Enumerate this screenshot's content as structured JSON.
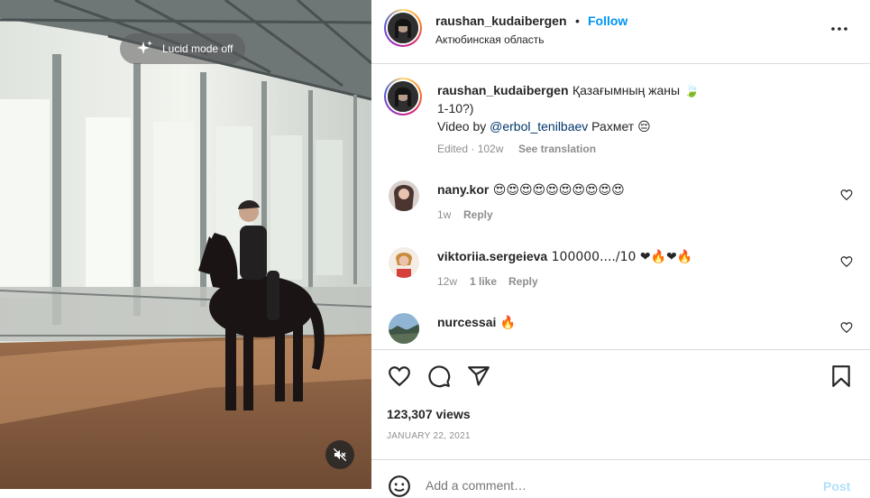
{
  "video": {
    "lucid_label": "Lucid mode off",
    "mute_icon": "speaker-muted-icon"
  },
  "header": {
    "username": "raushan_kudaibergen",
    "dot": "•",
    "follow_label": "Follow",
    "location": "Актюбинская область",
    "more_icon": "more-horizontal-icon"
  },
  "caption": {
    "username": "raushan_kudaibergen",
    "line1": "Қазағымның жаны",
    "line1_emoji": "🍃",
    "line2": "1-10?)",
    "line3_prefix": "Video by ",
    "line3_mention": "@erbol_tenilbaev",
    "line3_suffix": " Рахмет",
    "line3_emoji": "😔",
    "edited": "Edited · 102w",
    "translate": "See translation"
  },
  "comments": [
    {
      "username": "nany.kor",
      "text": "😍😍😍😍😍😍😍😍😍😍",
      "age": "1w",
      "likes": "",
      "reply": "Reply"
    },
    {
      "username": "viktoriia.sergeieva",
      "text": "100000..../10 ❤🔥❤🔥",
      "age": "12w",
      "likes": "1 like",
      "reply": "Reply"
    },
    {
      "username": "nurcessai",
      "text": "🔥",
      "age": "",
      "likes": "",
      "reply": ""
    }
  ],
  "stats": {
    "views": "123,307 views",
    "date": "JANUARY 22, 2021"
  },
  "composer": {
    "placeholder": "Add a comment…",
    "post_label": "Post"
  },
  "colors": {
    "accent": "#0095f6",
    "text": "#262626",
    "muted": "#8e8e8e",
    "link": "#00376b",
    "post_disabled": "#b2dffc",
    "border": "#dbdbdb"
  }
}
